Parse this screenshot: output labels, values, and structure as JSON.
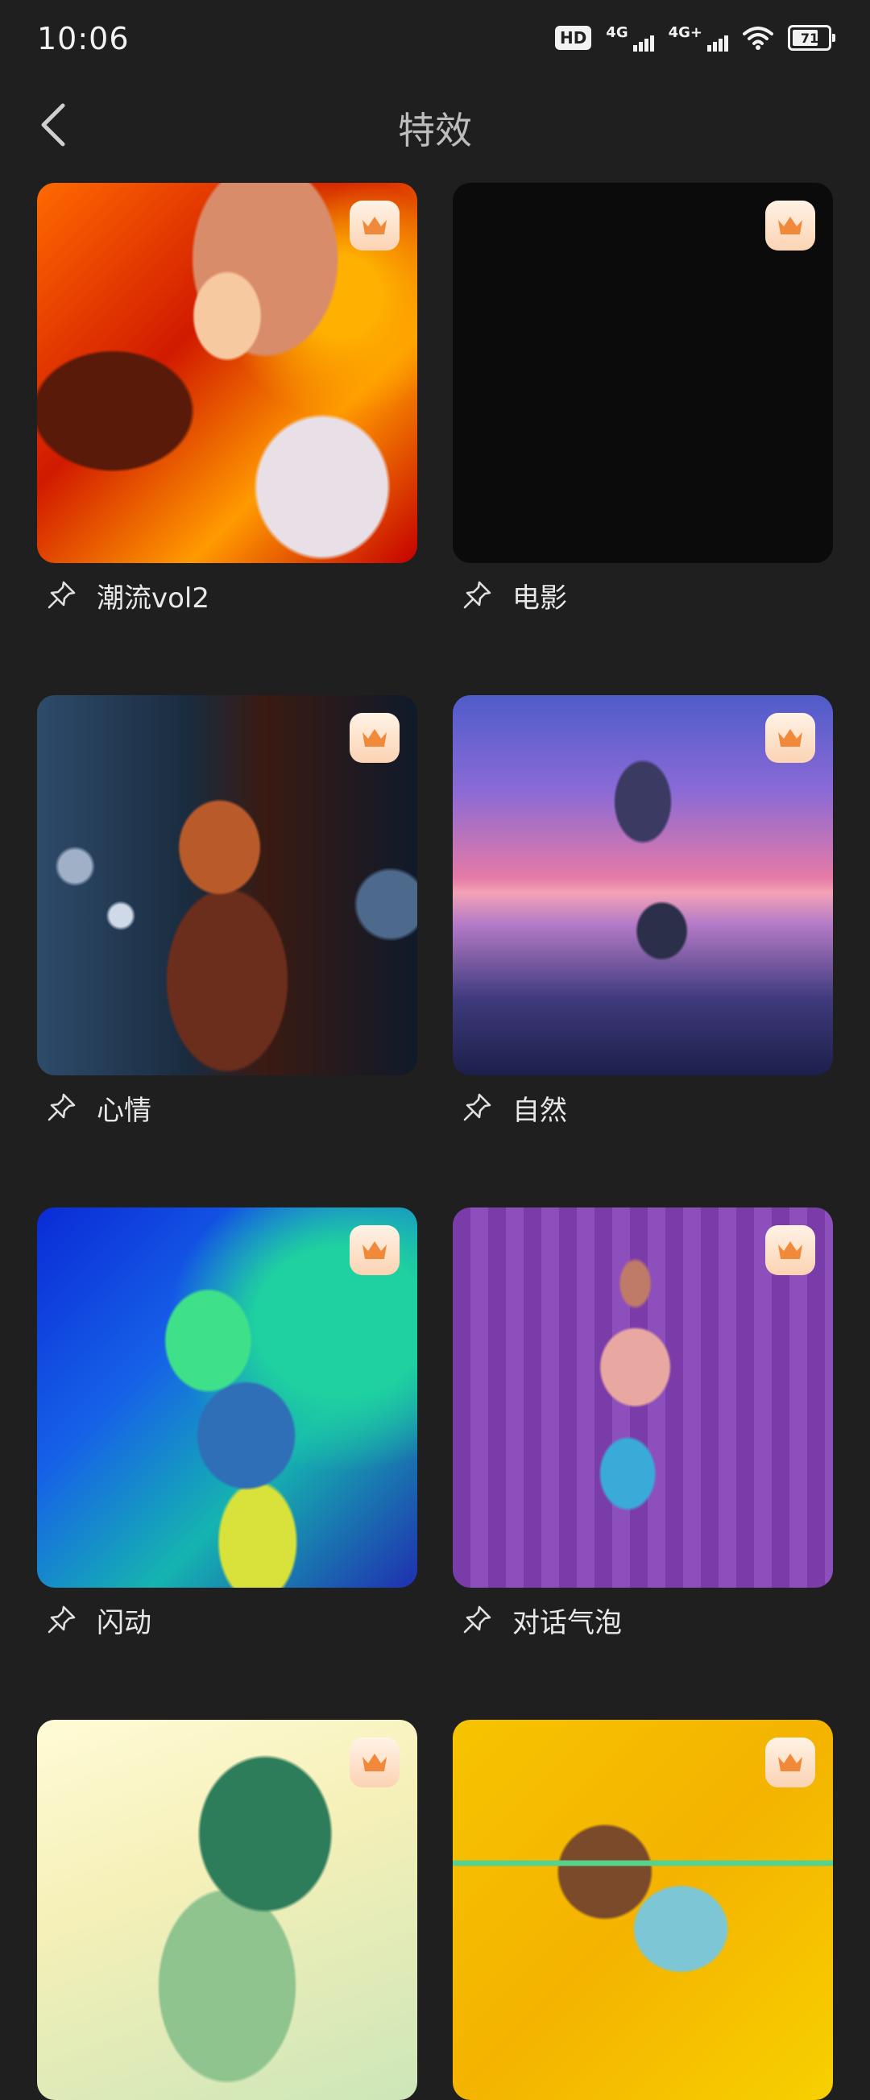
{
  "status_bar": {
    "time": "10:06",
    "hd_label": "HD",
    "sim1_label": "4G",
    "sim2_label": "4G+",
    "battery_level": "71"
  },
  "header": {
    "title": "特效",
    "back_icon": "chevron-left-icon"
  },
  "effects": [
    {
      "label": "潮流vol2",
      "premium": true
    },
    {
      "label": "电影",
      "premium": true
    },
    {
      "label": "心情",
      "premium": true
    },
    {
      "label": "自然",
      "premium": true
    },
    {
      "label": "闪动",
      "premium": true
    },
    {
      "label": "对话气泡",
      "premium": true
    },
    {
      "label": "",
      "premium": true
    },
    {
      "label": "",
      "premium": true
    }
  ],
  "colors": {
    "background": "#1f1f1f",
    "crown_badge": "#fbd3b3",
    "crown_icon": "#f08a3a"
  }
}
